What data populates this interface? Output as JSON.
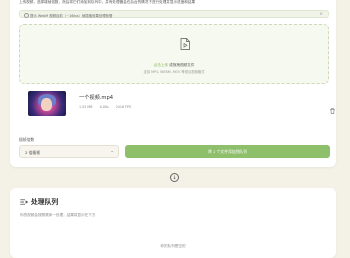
{
  "intro": "上传视频，选择增帧倍数，然后将它们添加到队列中，并有处理器会在后台的情况下进行处理并显示进度和结果",
  "notice": "提示 WebM 视频目前（~16fps）帧插值效果处理较慢",
  "upload": {
    "click_label": "点击上传",
    "drag_label": " 或拖拽视频文件",
    "formats": "支持 MP4, WEBM, MOV 等常见视频格式"
  },
  "file": {
    "name": "一个视频.mp4",
    "size": "1.52 MB",
    "duration": "0.00s",
    "resolution": "2416 FPS"
  },
  "options": {
    "count_label": "插帧倍数",
    "selected": "2 倍插帧",
    "add_button": "将 1 个文件添加到队列"
  },
  "queue": {
    "title": "处理队列",
    "description": "你的视频会按照顺序一处理，结果将显示在下方",
    "empty": "你的队列是空的"
  },
  "colors": {
    "accent": "#8ebf6a",
    "background": "#f4f1e6"
  },
  "icons": [
    "info-icon",
    "close-icon",
    "file-icon",
    "trash-icon",
    "chevron-down-icon",
    "arrow-down-icon",
    "queue-icon"
  ]
}
